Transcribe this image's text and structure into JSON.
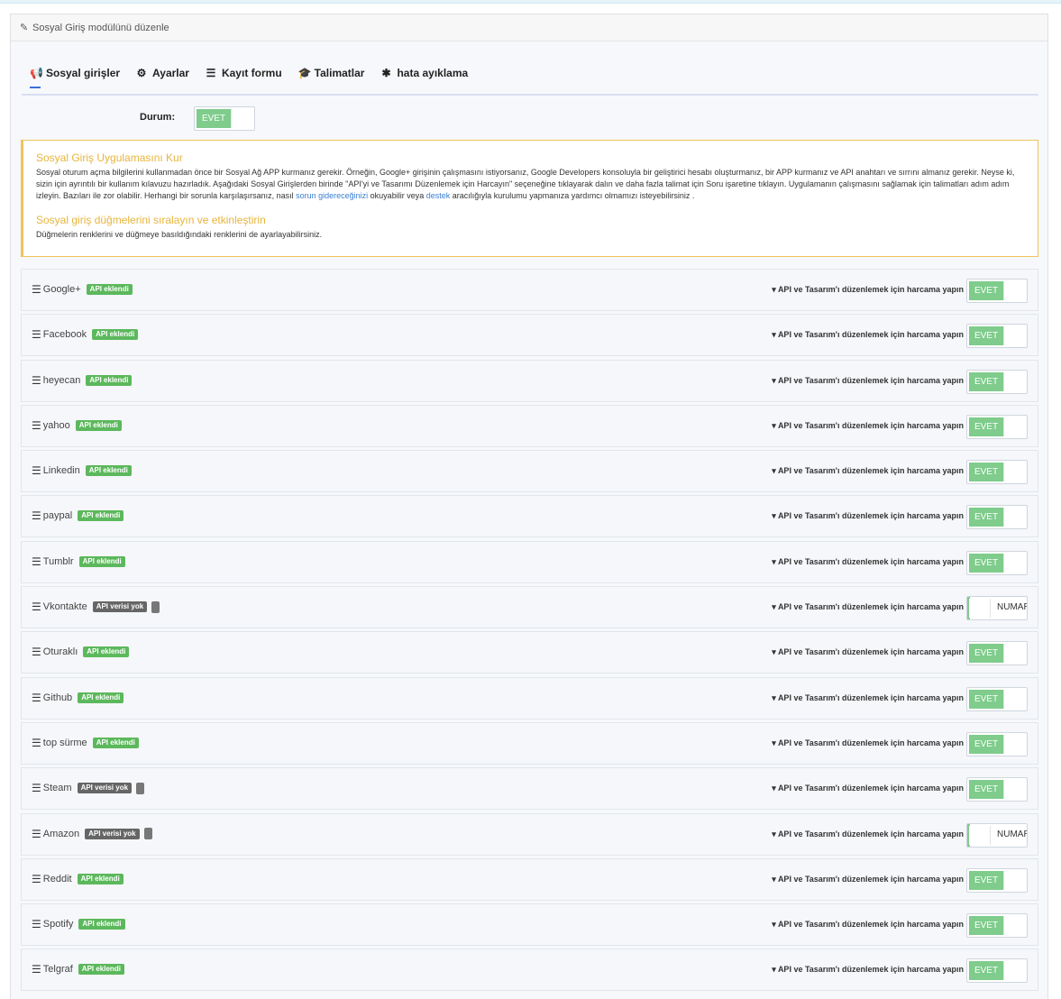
{
  "panel": {
    "title": "Sosyal Giriş modülünü düzenle",
    "icon": "pencil-icon"
  },
  "tabs": [
    {
      "label": "Sosyal girişler",
      "icon": "bullhorn-icon",
      "active": true
    },
    {
      "label": "Ayarlar",
      "icon": "gear-icon",
      "active": false
    },
    {
      "label": "Kayıt formu",
      "icon": "list-icon",
      "active": false
    },
    {
      "label": "Talimatlar",
      "icon": "graduation-cap-icon",
      "active": false
    },
    {
      "label": "hata ayıklama",
      "icon": "bug-icon",
      "active": false
    }
  ],
  "status": {
    "label": "Durum:",
    "toggle": "EVET"
  },
  "notice": {
    "title1": "Sosyal Giriş Uygulamasını Kur",
    "text1_a": "Sosyal oturum açma bilgilerini kullanmadan önce bir Sosyal Ağ APP kurmanız gerekir. Örneğin, Google+ girişinin çalışmasını istiyorsanız, Google Developers konsoluyla bir geliştirici hesabı oluşturmanız, bir APP kurmanız ve API anahtarı ve sırrını almanız gerekir. Neyse ki, sizin için ayrıntılı bir kullanım kılavuzu hazırladık. Aşağıdaki Sosyal Girişlerden birinde \"API'yi ve Tasarımı Düzenlemek için Harcayın\" seçeneğine tıklayarak dalın ve daha fazla talimat için Soru işaretine tıklayın. Uygulamanın çalışmasını sağlamak için talimatları adım adım izleyin. Bazıları ile zor olabilir. Herhangi bir sorunla karşılaşırsanız, nasıl ",
    "link1": "sorun gidereceğinizi",
    "text1_b": " okuyabilir veya ",
    "link2": "destek",
    "text1_c": " aracılığıyla kurulumu yapmanıza yardımcı olmamızı isteyebilirsiniz .",
    "title2": "Sosyal giriş düğmelerini sıralayın ve etkinleştirin",
    "text2": "Düğmelerin renklerini ve düğmeye basıldığındaki renklerini de ayarlayabilirsiniz."
  },
  "edit_label": "API ve Tasarım'ı düzenlemek için harcama yapın",
  "on_label": "EVET",
  "off_label": "NUMARA",
  "providers": [
    {
      "name": "Google+",
      "badge": "API eklendi",
      "state": "on"
    },
    {
      "name": "Facebook",
      "badge": "API eklendi",
      "state": "on"
    },
    {
      "name": "heyecan",
      "badge": "API eklendi",
      "state": "on"
    },
    {
      "name": "yahoo",
      "badge": "API eklendi",
      "state": "on"
    },
    {
      "name": "Linkedin",
      "badge": "API eklendi",
      "state": "on"
    },
    {
      "name": "paypal",
      "badge": "API eklendi",
      "state": "on"
    },
    {
      "name": "Tumblr",
      "badge": "API eklendi",
      "state": "on"
    },
    {
      "name": "Vkontakte",
      "badge": "API verisi yok",
      "state": "off"
    },
    {
      "name": "Oturaklı",
      "badge": "API eklendi",
      "state": "on"
    },
    {
      "name": "Github",
      "badge": "API eklendi",
      "state": "on"
    },
    {
      "name": "top sürme",
      "badge": "API eklendi",
      "state": "on"
    },
    {
      "name": "Steam",
      "badge": "API verisi yok",
      "state": "on"
    },
    {
      "name": "Amazon",
      "badge": "API verisi yok",
      "state": "off"
    },
    {
      "name": "Reddit",
      "badge": "API eklendi",
      "state": "on"
    },
    {
      "name": "Spotify",
      "badge": "API eklendi",
      "state": "on"
    },
    {
      "name": "Telgraf",
      "badge": "API eklendi",
      "state": "on"
    }
  ]
}
